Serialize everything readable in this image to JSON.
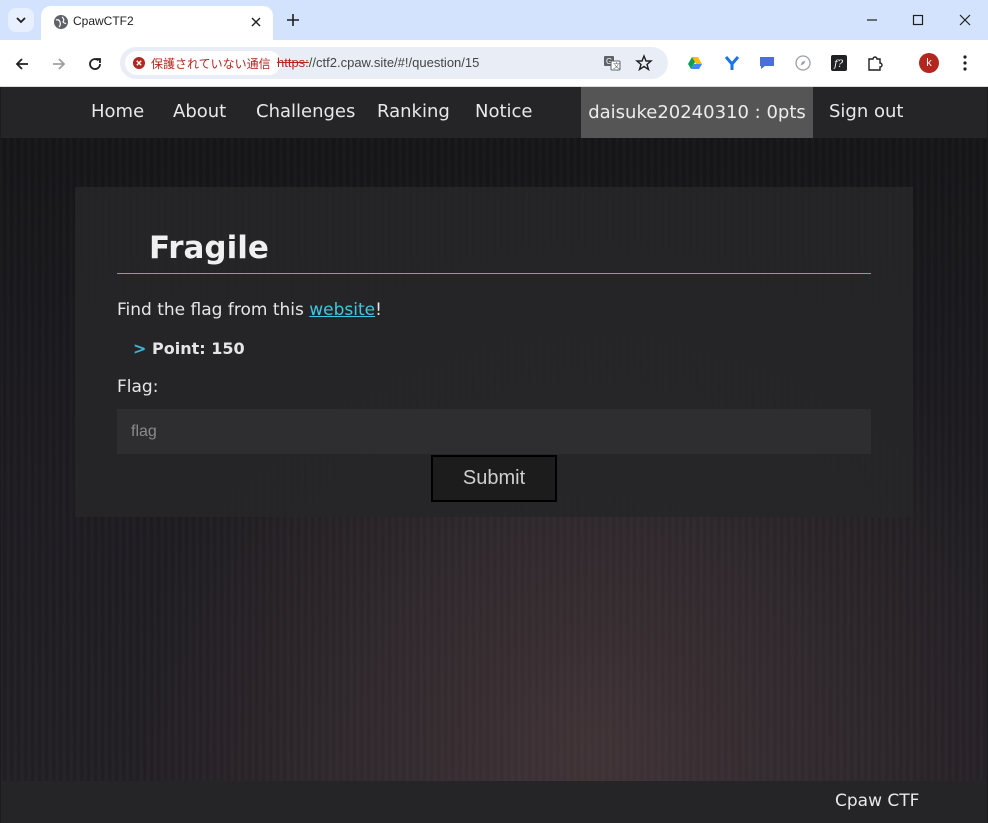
{
  "browser": {
    "tab_title": "CpawCTF2",
    "security_label": "保護されていない通信",
    "url_scheme": "https:",
    "url_rest": "//ctf2.cpaw.site/#!/question/15",
    "profile_initial": "k"
  },
  "site": {
    "nav": {
      "home": "Home",
      "about": "About",
      "challenges": "Challenges",
      "ranking": "Ranking",
      "notice": "Notice",
      "user_status": "daisuke20240310 : 0pts",
      "sign_out": "Sign out"
    },
    "question": {
      "title": "Fragile",
      "desc_before": "Find the flag from this ",
      "desc_link": "website",
      "desc_after": "!",
      "point_arrow": ">",
      "point_label": "Point: 150",
      "flag_label": "Flag:",
      "flag_placeholder": "flag",
      "submit_label": "Submit"
    },
    "footer": "Cpaw CTF"
  },
  "colors": {
    "accent": "#3fb6d6",
    "link": "#3fc7e0",
    "nav_bg": "#252527",
    "user_bg": "#555556",
    "insecure": "#b3261e"
  }
}
